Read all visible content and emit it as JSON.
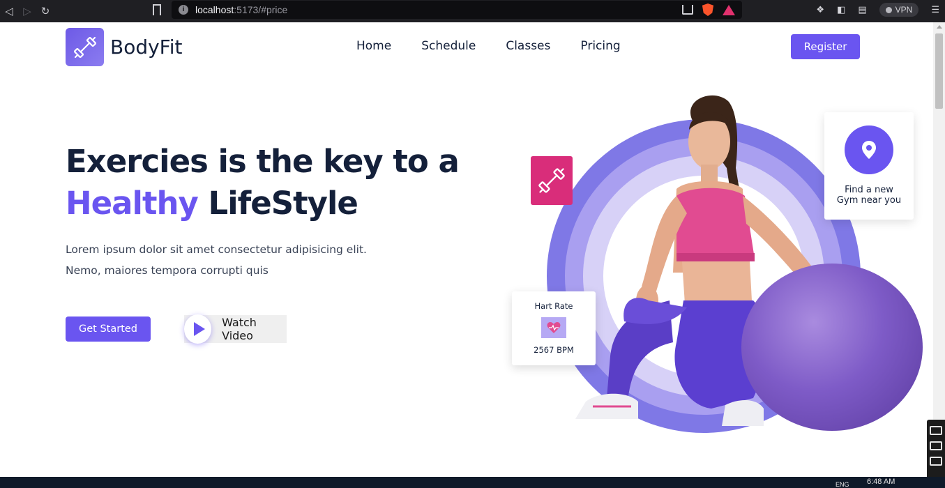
{
  "browser": {
    "url_host": "localhost",
    "url_rest": ":5173/#price",
    "vpn_label": "VPN"
  },
  "site": {
    "logo_text": "BodyFit",
    "nav": [
      "Home",
      "Schedule",
      "Classes",
      "Pricing"
    ],
    "register_label": "Register"
  },
  "hero": {
    "title_line1": "Exercies is the key to a",
    "title_accent": "Healthy",
    "title_line2_rest": " LifeStyle",
    "desc_line1": "Lorem ipsum dolor sit amet consectetur adipisicing elit.",
    "desc_line2": "Nemo, maiores tempora corrupti quis",
    "cta_primary": "Get Started",
    "cta_video": "Watch Video"
  },
  "cards": {
    "gym_line1": "Find a new",
    "gym_line2": "Gym near you",
    "hr_title": "Hart Rate",
    "hr_value": "2567 BPM"
  },
  "taskbar": {
    "lang": "ENG",
    "time": "6:48 AM"
  },
  "colors": {
    "accent": "#6a55f0",
    "pink": "#d92d7a",
    "ring_outer": "#7f78e6",
    "text_dark": "#14203a"
  },
  "icons": [
    "dumbbell-icon",
    "location-pin-icon",
    "heartbeat-icon",
    "play-icon"
  ]
}
